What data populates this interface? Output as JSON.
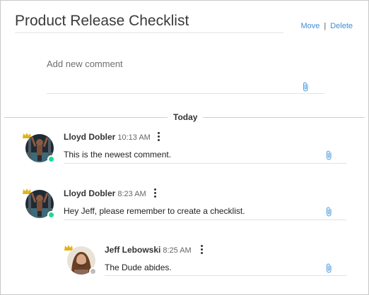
{
  "header": {
    "title": "Product Release Checklist",
    "move_label": "Move",
    "separator": "|",
    "delete_label": "Delete"
  },
  "composer": {
    "placeholder": "Add new comment"
  },
  "day_label": "Today",
  "colors": {
    "accent": "#3b8fd4",
    "online": "#1ddc8f",
    "offline": "#bdbdbd",
    "crown": "#e0b418"
  },
  "comments": [
    {
      "author": "Lloyd Dobler",
      "time": "10:13 AM",
      "text": "This is the newest comment.",
      "status": "online",
      "is_reply": false
    },
    {
      "author": "Lloyd Dobler",
      "time": "8:23 AM",
      "text": "Hey Jeff, please remember to create a checklist.",
      "status": "online",
      "is_reply": false
    },
    {
      "author": "Jeff Lebowski",
      "time": "8:25 AM",
      "text": "The Dude abides.",
      "status": "offline",
      "is_reply": true
    }
  ],
  "icons": {
    "attach": "paperclip-icon",
    "more": "kebab-menu-icon",
    "admin": "crown-icon"
  }
}
